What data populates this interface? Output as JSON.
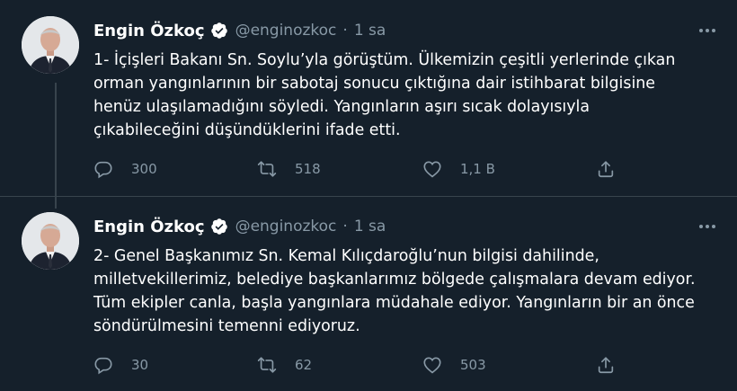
{
  "tweets": [
    {
      "author": {
        "name": "Engin Özkoç",
        "handle": "@enginozkoc"
      },
      "separator": "·",
      "time": "1 sa",
      "text": "1- İçişleri Bakanı Sn. Soylu’yla görüştüm. Ülkemizin çeşitli yerlerinde çıkan\norman yangınlarının bir sabotaj sonucu çıktığına dair istihbarat bilgisine\nhenüz ulaşılamadığını söyledi. Yangınların aşırı sıcak dolayısıyla\nçıkabileceğini düşündüklerini ifade etti.",
      "counts": {
        "replies": "300",
        "retweets": "518",
        "likes": "1,1 B"
      }
    },
    {
      "author": {
        "name": "Engin Özkoç",
        "handle": "@enginozkoc"
      },
      "separator": "·",
      "time": "1 sa",
      "text": "2- Genel Başkanımız Sn. Kemal Kılıçdaroğlu’nun bilgisi dahilinde,\nmilletvekillerimiz, belediye başkanlarımız bölgede çalışmalara devam ediyor.\nTüm ekipler canla, başla yangınlara müdahale ediyor. Yangınların bir an önce\nsöndürülmesini temenni ediyoruz.",
      "counts": {
        "replies": "30",
        "retweets": "62",
        "likes": "503"
      }
    }
  ],
  "icons": {
    "verified": "verified-badge-icon",
    "more": "more-options-icon",
    "reply": "reply-icon",
    "retweet": "retweet-icon",
    "like": "like-icon",
    "share": "share-icon"
  },
  "colors": {
    "background": "#15202b",
    "text": "#ffffff",
    "secondary": "#8899a6",
    "border": "#38444d"
  }
}
